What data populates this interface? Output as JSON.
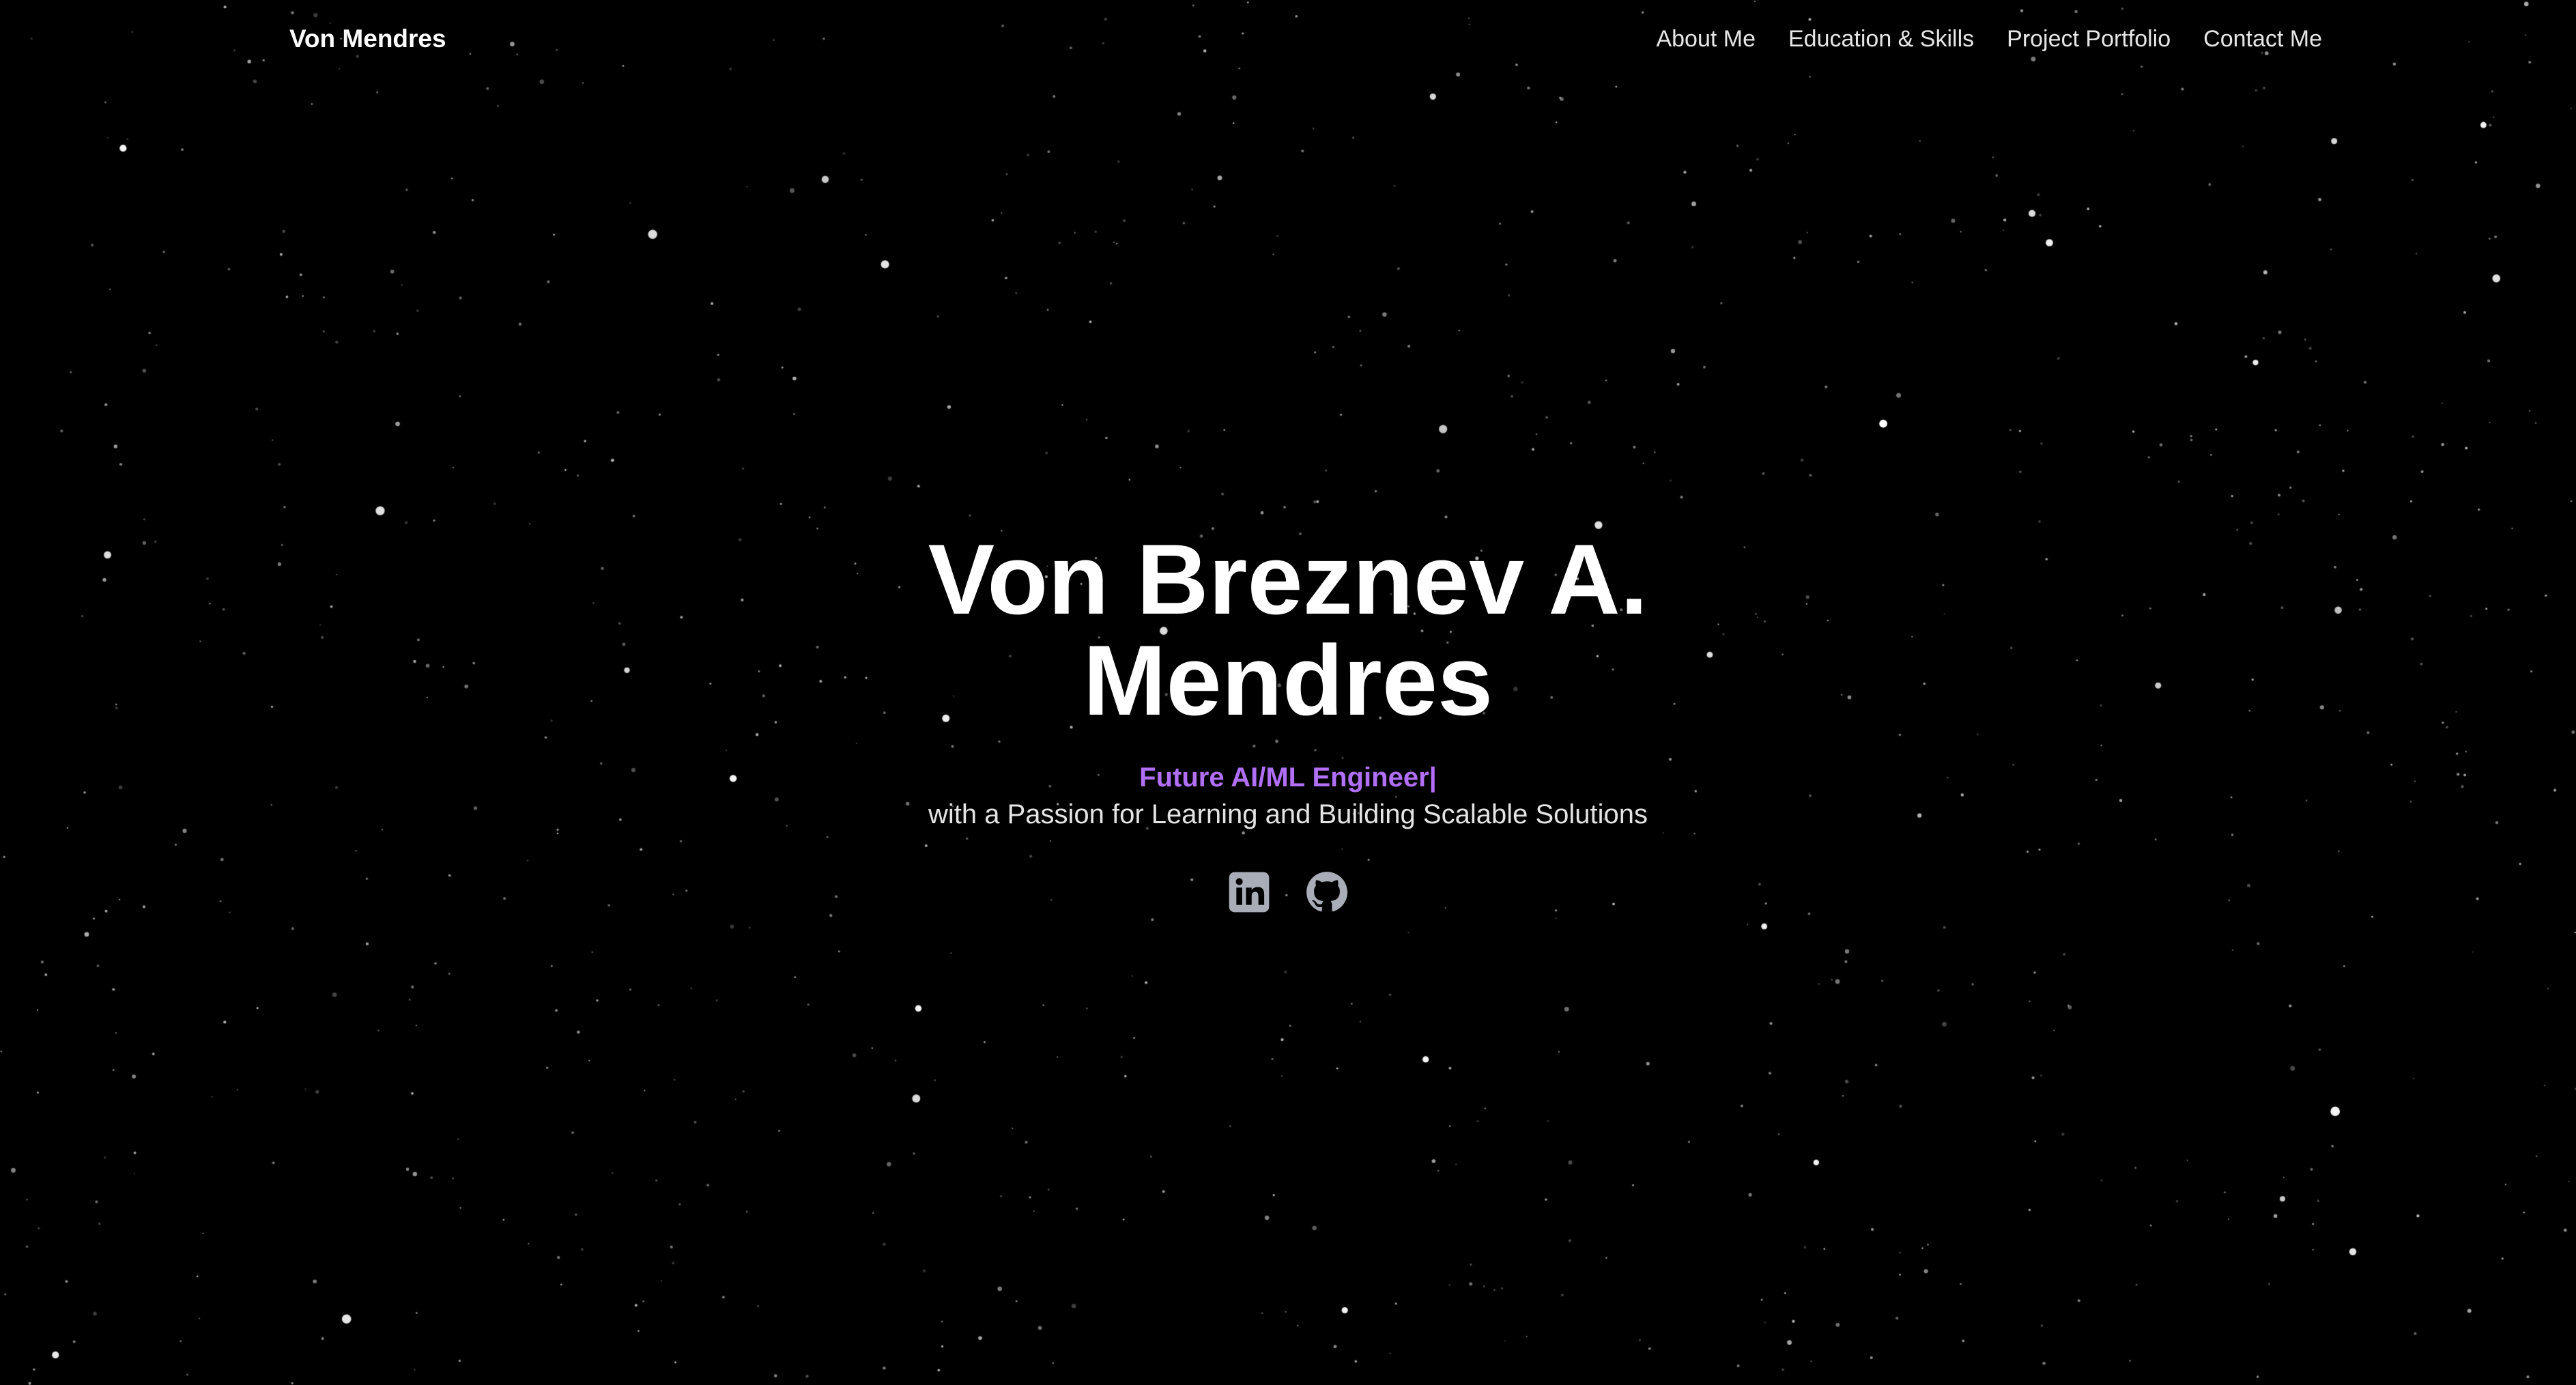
{
  "nav": {
    "brand": "Von Mendres",
    "links": [
      {
        "label": "About Me"
      },
      {
        "label": "Education & Skills"
      },
      {
        "label": "Project Portfolio"
      },
      {
        "label": "Contact Me"
      }
    ]
  },
  "hero": {
    "name_line1": "Von Breznev A.",
    "name_line2": "Mendres",
    "role": "Future AI/ML Engineer|",
    "tagline": "with a Passion for Learning and Building Scalable Solutions",
    "socials": [
      {
        "icon": "linkedin-icon"
      },
      {
        "icon": "github-icon"
      }
    ]
  },
  "colors": {
    "background": "#000000",
    "accent": "#b16ff5",
    "text": "#ffffff",
    "icon": "#a8adb8"
  }
}
